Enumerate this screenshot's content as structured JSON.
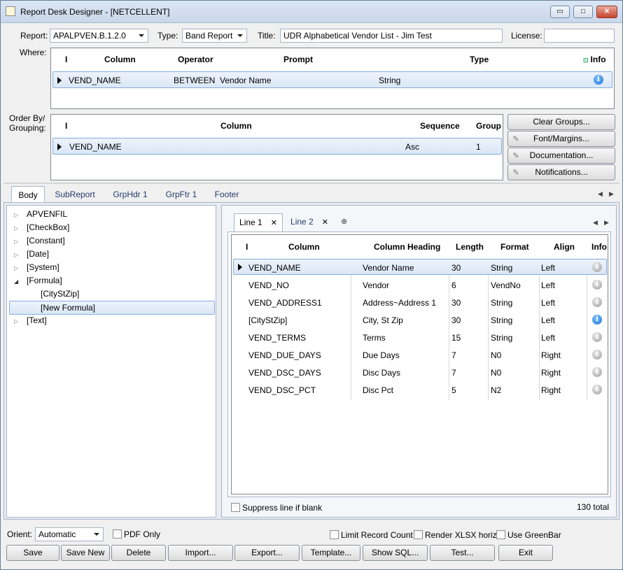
{
  "window": {
    "title": "Report Desk Designer - [NETCELLENT]",
    "min_label": "▭",
    "max_label": "□",
    "close_label": "✕"
  },
  "header": {
    "report_label": "Report:",
    "report_value": "APALPVEN.B.1.2.0",
    "type_label": "Type:",
    "type_value": "Band Report",
    "title_label": "Title:",
    "title_value": "UDR Alphabetical Vendor List - Jim Test",
    "license_label": "License:",
    "license_value": ""
  },
  "where": {
    "label": "Where:",
    "columns": {
      "marker": "I",
      "column": "Column",
      "operator": "Operator",
      "prompt": "Prompt",
      "type": "Type",
      "info": "Info"
    },
    "rows": [
      {
        "column": "VEND_NAME",
        "operator": "BETWEEN",
        "prompt": "Vendor Name",
        "type": "String"
      }
    ]
  },
  "orderby": {
    "label": "Order By/\nGrouping:",
    "label_line1": "Order By/",
    "label_line2": "Grouping:",
    "columns": {
      "marker": "I",
      "column": "Column",
      "sequence": "Sequence",
      "group": "Group"
    },
    "rows": [
      {
        "column": "VEND_NAME",
        "sequence": "Asc",
        "group": "1"
      }
    ]
  },
  "side_buttons": [
    "Clear Groups...",
    "Font/Margins...",
    "Documentation...",
    "Notifications..."
  ],
  "main_tabs": [
    "Body",
    "SubReport",
    "GrpHdr 1",
    "GrpFtr 1",
    "Footer"
  ],
  "tree": [
    "APVENFIL",
    "[CheckBox]",
    "[Constant]",
    "[Date]",
    "[System]",
    "[Formula]",
    "[CityStZip]",
    "[New Formula]",
    "[Text]"
  ],
  "line_tabs": [
    "Line 1",
    "Line 2"
  ],
  "line_grid": {
    "columns": {
      "marker": "I",
      "column": "Column",
      "heading": "Column Heading",
      "length": "Length",
      "format": "Format",
      "align": "Align",
      "info": "Info"
    },
    "rows": [
      {
        "column": "VEND_NAME",
        "heading": "Vendor Name",
        "length": "30",
        "format": "String",
        "align": "Left"
      },
      {
        "column": "VEND_NO",
        "heading": "Vendor",
        "length": "6",
        "format": "VendNo",
        "align": "Left"
      },
      {
        "column": "VEND_ADDRESS1",
        "heading": "Address~Address 1",
        "length": "30",
        "format": "String",
        "align": "Left"
      },
      {
        "column": "[CityStZip]",
        "heading": "City, St Zip",
        "length": "30",
        "format": "String",
        "align": "Left"
      },
      {
        "column": "VEND_TERMS",
        "heading": "Terms",
        "length": "15",
        "format": "String",
        "align": "Left"
      },
      {
        "column": "VEND_DUE_DAYS",
        "heading": "Due Days",
        "length": "7",
        "format": "N0",
        "align": "Right"
      },
      {
        "column": "VEND_DSC_DAYS",
        "heading": "Disc Days",
        "length": "7",
        "format": "N0",
        "align": "Right"
      },
      {
        "column": "VEND_DSC_PCT",
        "heading": "Disc Pct",
        "length": "5",
        "format": "N2",
        "align": "Right"
      }
    ]
  },
  "suppress_label": "Suppress line if blank",
  "total_label": "130 total",
  "bottom": {
    "orient_label": "Orient:",
    "orient_value": "Automatic",
    "pdf_only": "PDF Only",
    "limit_record": "Limit Record Count",
    "render_xlsx": "Render XLSX horiz.",
    "use_greenbar": "Use GreenBar"
  },
  "action_buttons": [
    "Save",
    "Save New",
    "Delete",
    "Import...",
    "Export...",
    "Template...",
    "Show SQL...",
    "Test...",
    "Exit"
  ]
}
